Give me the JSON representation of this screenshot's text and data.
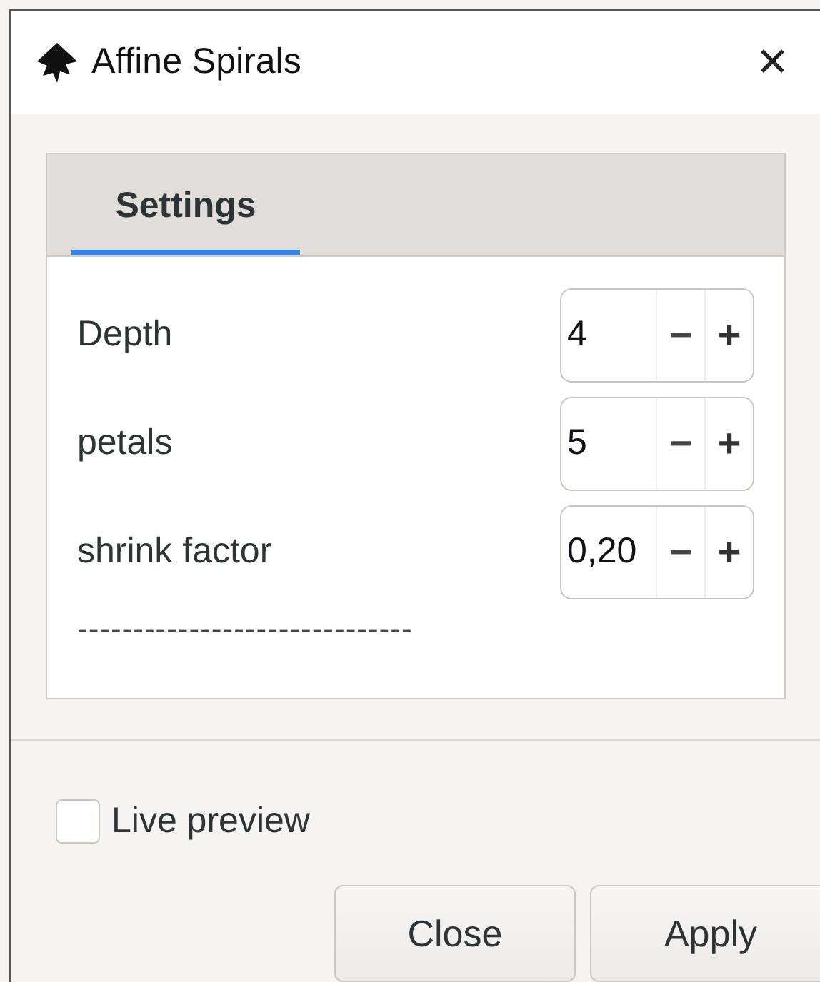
{
  "window": {
    "title": "Affine Spirals",
    "close": "✕"
  },
  "tabs": [
    {
      "label": "Settings",
      "selected": true
    }
  ],
  "fields": [
    {
      "label": "Depth",
      "value": "4",
      "minus": "−",
      "plus": "+"
    },
    {
      "label": "petals",
      "value": "5",
      "minus": "−",
      "plus": "+"
    },
    {
      "label": "shrink factor",
      "value": "0,20",
      "minus": "−",
      "plus": "+"
    }
  ],
  "separator_text": "------------------------------",
  "live_preview": {
    "label": "Live preview",
    "checked": false
  },
  "buttons": [
    "Close",
    "Apply"
  ]
}
